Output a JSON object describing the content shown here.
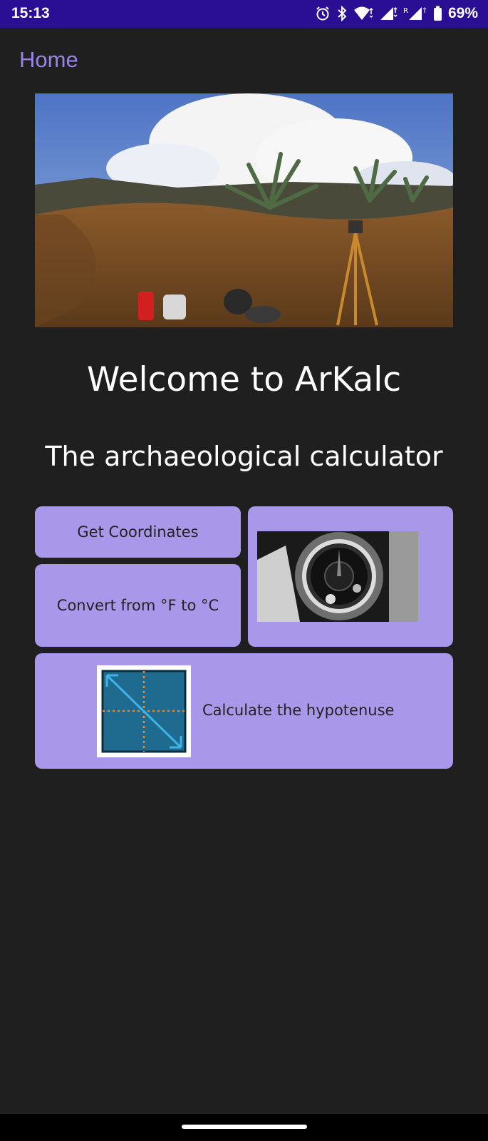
{
  "status_bar": {
    "time": "15:13",
    "battery": "69%",
    "icons": [
      "alarm-icon",
      "bluetooth-icon",
      "wifi-icon",
      "signal-icon",
      "roaming-signal-icon",
      "battery-icon"
    ]
  },
  "app": {
    "title": "Home"
  },
  "hero": {
    "icon": "landscape-photo"
  },
  "welcome": {
    "title": "Welcome to ArKalc",
    "subtitle": "The archaeological calculator"
  },
  "actions": {
    "get_coordinates": "Get Coordinates",
    "convert_temp": "Convert from °F to °C",
    "compass": "compass-photo",
    "hypotenuse": "Calculate the hypotenuse"
  },
  "colors": {
    "status_bar": "#2a0f94",
    "accent": "#9b82e6",
    "card": "#a998ea",
    "background": "#1f1f1f"
  }
}
